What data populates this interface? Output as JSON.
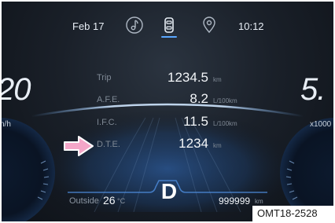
{
  "status_bar": {
    "date": "Feb 17",
    "time": "10:12",
    "tabs": [
      {
        "icon": "music-note-icon"
      },
      {
        "icon": "car-icon",
        "active": true
      },
      {
        "icon": "location-pin-icon"
      }
    ]
  },
  "speedometer": {
    "value": "20",
    "unit": "n/h"
  },
  "tachometer": {
    "value": "5.",
    "unit": "x1000"
  },
  "trip_info": [
    {
      "label": "Trip",
      "value": "1234.5",
      "unit": "km"
    },
    {
      "label": "A.F.E.",
      "value": "8.2",
      "unit": "L/100km"
    },
    {
      "label": "I.F.C.",
      "value": "11.5",
      "unit": "L/100km"
    },
    {
      "label": "D.T.E.",
      "value": "1234",
      "unit": "km"
    }
  ],
  "gear": "D",
  "outside": {
    "label": "Outside",
    "value": "26",
    "unit": "°C"
  },
  "odometer": {
    "value": "999999",
    "unit": "km"
  },
  "figure_code": "OMT18-2528",
  "colors": {
    "accent": "#5aa7ff",
    "arrow": "#f4a6c8",
    "background": "#141a22"
  }
}
